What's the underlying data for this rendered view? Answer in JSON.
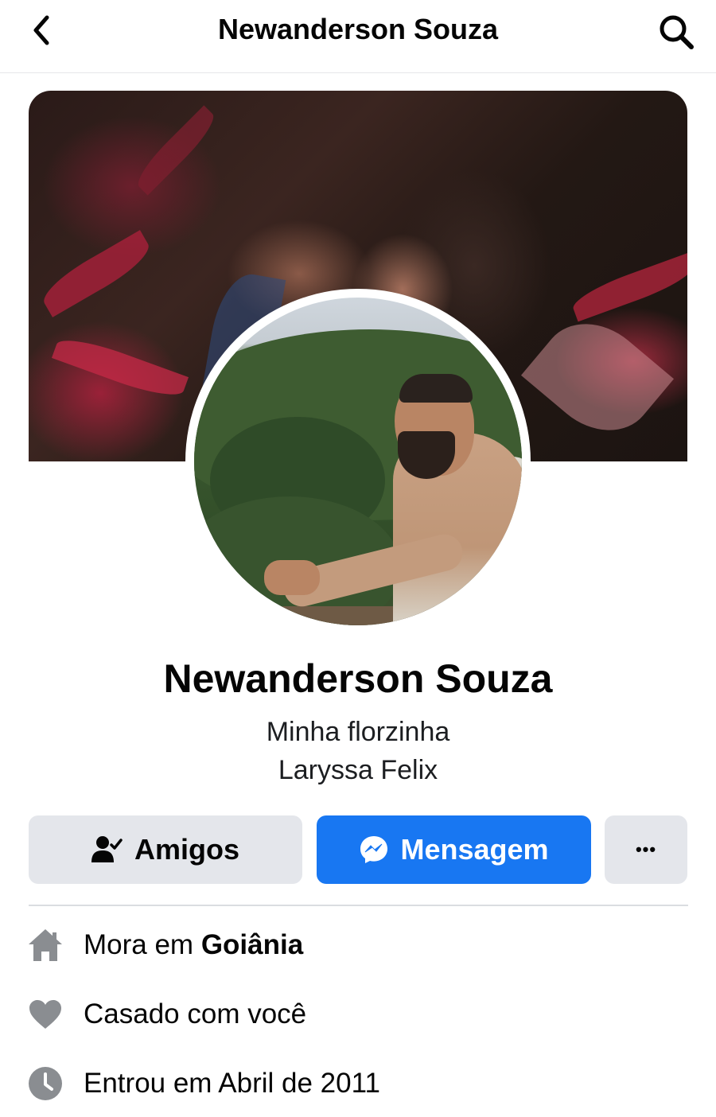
{
  "header": {
    "title": "Newanderson Souza",
    "back_icon": "chevron-left-icon",
    "search_icon": "search-icon"
  },
  "profile": {
    "name": "Newanderson Souza",
    "bio_line1": "Minha florzinha",
    "bio_line2": "Laryssa Felix"
  },
  "actions": {
    "friends_label": "Amigos",
    "friends_icon": "person-check-icon",
    "message_label": "Mensagem",
    "message_icon": "messenger-icon",
    "more_label": "•••",
    "message_color": "#1877f2"
  },
  "details": [
    {
      "icon": "home-icon",
      "prefix": "Mora em ",
      "bold": "Goiânia"
    },
    {
      "icon": "heart-icon",
      "prefix": "Casado com você",
      "bold": ""
    },
    {
      "icon": "clock-icon",
      "prefix": "Entrou em Abril de 2011",
      "bold": ""
    }
  ]
}
